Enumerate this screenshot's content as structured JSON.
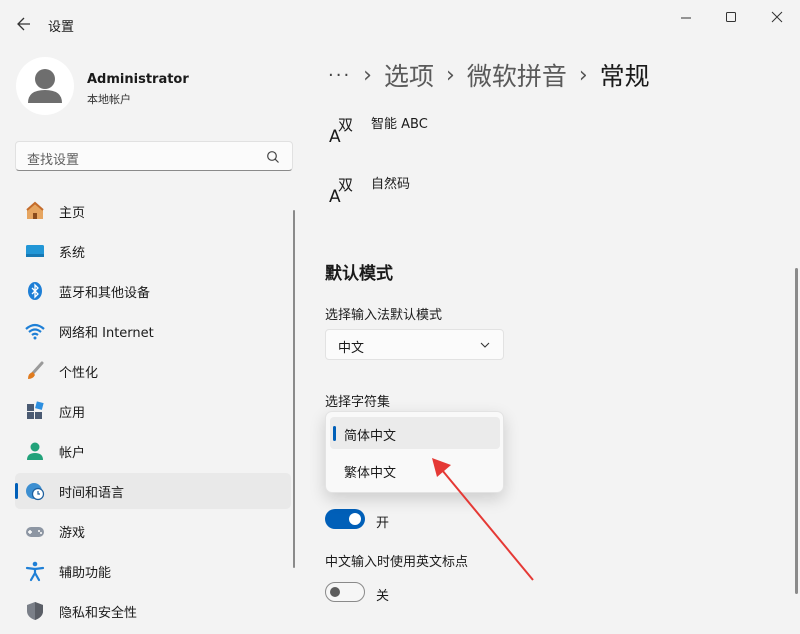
{
  "window": {
    "title": "设置",
    "controls": [
      "minimize",
      "maximize",
      "close"
    ]
  },
  "user": {
    "name": "Administrator",
    "account_type": "本地帐户"
  },
  "search": {
    "placeholder": "查找设置"
  },
  "sidebar": {
    "items": [
      {
        "label": "主页",
        "icon": "home-icon",
        "active": false
      },
      {
        "label": "系统",
        "icon": "display-icon",
        "active": false
      },
      {
        "label": "蓝牙和其他设备",
        "icon": "bluetooth-icon",
        "active": false
      },
      {
        "label": "网络和 Internet",
        "icon": "wifi-icon",
        "active": false
      },
      {
        "label": "个性化",
        "icon": "brush-icon",
        "active": false
      },
      {
        "label": "应用",
        "icon": "apps-icon",
        "active": false
      },
      {
        "label": "帐户",
        "icon": "person-icon",
        "active": false
      },
      {
        "label": "时间和语言",
        "icon": "globe-clock-icon",
        "active": true
      },
      {
        "label": "游戏",
        "icon": "gamepad-icon",
        "active": false
      },
      {
        "label": "辅助功能",
        "icon": "accessibility-icon",
        "active": false
      },
      {
        "label": "隐私和安全性",
        "icon": "shield-icon",
        "active": false
      }
    ]
  },
  "breadcrumb": {
    "overflow": "···",
    "items": [
      "选项",
      "微软拼音",
      "常规"
    ]
  },
  "main": {
    "options": [
      {
        "label": "智能 ABC",
        "icon": "ime-ab-icon"
      },
      {
        "label": "自然码",
        "icon": "ime-ab-icon"
      }
    ],
    "default_mode": {
      "section_title": "默认模式",
      "mode_label": "选择输入法默认模式",
      "mode_value": "中文",
      "charset_label": "选择字符集",
      "charset_options": [
        {
          "label": "简体中文",
          "selected": true
        },
        {
          "label": "繁体中文",
          "selected": false
        }
      ]
    },
    "toggle1": {
      "state_label": "开",
      "on": true
    },
    "toggle2": {
      "label": "中文输入时使用英文标点",
      "state_label": "关",
      "on": false
    }
  },
  "colors": {
    "accent": "#005fb8",
    "background": "#f3f3f3",
    "annotation_arrow": "#e53935"
  }
}
